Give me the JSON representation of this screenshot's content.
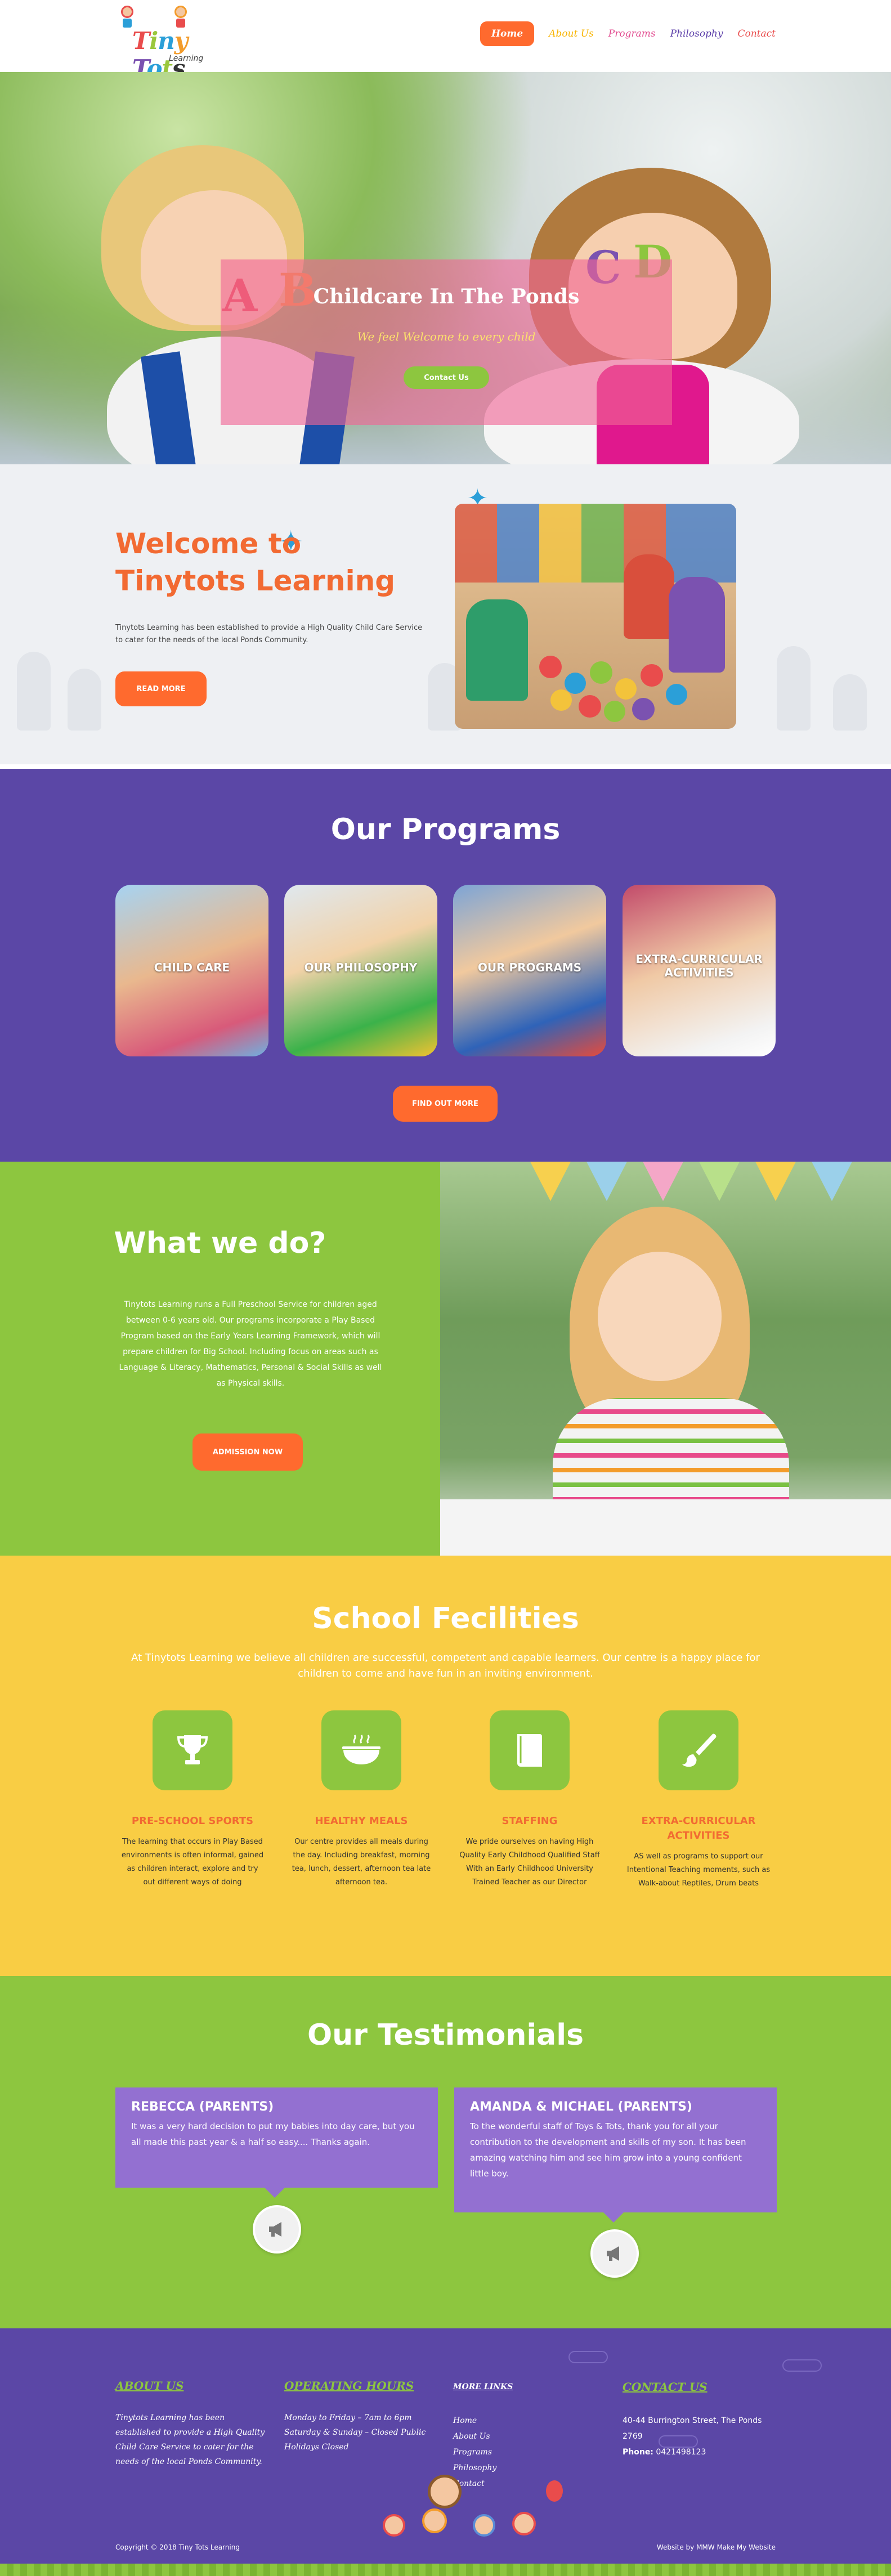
{
  "header": {
    "logo": {
      "word": [
        "T",
        "i",
        "n",
        "y",
        " ",
        "T",
        "o",
        "t",
        "s"
      ],
      "sub": "Learning"
    },
    "nav": [
      {
        "label": "Home",
        "active": true
      },
      {
        "label": "About Us"
      },
      {
        "label": "Programs"
      },
      {
        "label": "Philosophy"
      },
      {
        "label": "Contact"
      }
    ]
  },
  "hero": {
    "title": "Childcare In The Ponds",
    "subtitle": "We feel Welcome to every child",
    "button": "Contact Us",
    "letters": [
      "A",
      "B",
      "C",
      "D"
    ]
  },
  "welcome": {
    "title": "Welcome to Tinytots Learning",
    "text": "Tinytots Learning has been established to provide a High Quality Child Care Service to cater for the needs of the local Ponds Community.",
    "button": "READ MORE"
  },
  "programs": {
    "title": "Our Programs",
    "cards": [
      {
        "label": "CHILD CARE"
      },
      {
        "label": "OUR PHILOSOPHY"
      },
      {
        "label": "OUR PROGRAMS"
      },
      {
        "label": "EXTRA-CURRICULAR ACTIVITIES"
      }
    ],
    "button": "FIND OUT MORE"
  },
  "whatwedo": {
    "title": "What we do?",
    "text": "Tinytots Learning runs a Full Preschool Service for children aged between 0-6 years old. Our programs incorporate a Play Based Program based on the Early Years Learning Framework, which will prepare children for Big School. Including focus on areas such as Language & Literacy, Mathematics, Personal & Social Skills as well as Physical skills.",
    "button": "ADMISSION NOW"
  },
  "facilities": {
    "title": "School Fecilities",
    "intro": "At Tinytots Learning we believe all children are successful, competent and capable learners. Our centre is a happy place for children to come and have fun in an inviting environment.",
    "items": [
      {
        "icon": "trophy-icon",
        "title": "PRE-SCHOOL SPORTS",
        "text": "The learning that occurs in Play Based environments is often informal, gained as children interact, explore and try out different ways of doing"
      },
      {
        "icon": "meal-icon",
        "title": "HEALTHY MEALS",
        "text": "Our centre provides all meals during the day. Including breakfast, morning tea, lunch, dessert, afternoon tea late afternoon tea."
      },
      {
        "icon": "book-icon",
        "title": "STAFFING",
        "text": "We pride ourselves on having High Quality Early Childhood Qualified Staff With an Early Childhood University Trained Teacher as our Director"
      },
      {
        "icon": "paintbrush-icon",
        "title": "EXTRA-CURRICULAR ACTIVITIES",
        "text": "AS well as programs to support our Intentional Teaching moments, such as Walk-about Reptiles, Drum beats"
      }
    ]
  },
  "testimonials": {
    "title": "Our Testimonials",
    "items": [
      {
        "name": "REBECCA (PARENTS)",
        "text": "It was a very hard decision to put my babies into day care, but you all made this past year & a half so easy.... Thanks again."
      },
      {
        "name": "AMANDA & MICHAEL (PARENTS)",
        "text": "To the wonderful staff of Toys & Tots, thank you for all your contribution to the development and skills of my son. It has been amazing watching him and see him grow into a young confident little boy."
      }
    ]
  },
  "footer": {
    "about": {
      "heading": "ABOUT US",
      "text": "Tinytots Learning has been established to provide a High Quality Child Care Service to cater for the needs of the local Ponds Community."
    },
    "hours": {
      "heading": "OPERATING HOURS",
      "lines": [
        "Monday to Friday – 7am to 6pm",
        "Saturday & Sunday – Closed Public",
        "Holidays Closed"
      ]
    },
    "links": {
      "heading": "MORE LINKS",
      "items": [
        "Home",
        "About Us",
        "Programs",
        "Philosophy",
        "Contact"
      ]
    },
    "contact": {
      "heading": "CONTACT US",
      "address": "40-44 Burrington Street, The Ponds",
      "postcode": "2769",
      "phone_label": "Phone:",
      "phone": "0421498123"
    },
    "copyright": "Copyright © 2018 Tiny Tots Learning",
    "credit": "Website by MMW Make My Website"
  },
  "colors": {
    "orange": "#ff6a2e",
    "purple": "#5b47a6",
    "green": "#8dc63f",
    "yellow": "#f9cd44",
    "pink_overlay": "#f16696"
  }
}
